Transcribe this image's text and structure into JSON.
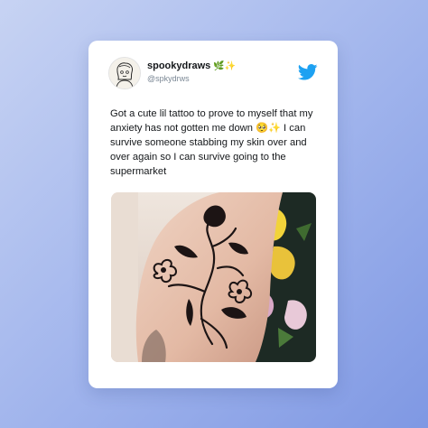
{
  "tweet": {
    "display_name": "spookydraws",
    "name_emoji": "🌿✨",
    "handle": "@spkydrws",
    "text": "Got a cute lil tattoo to prove to myself that my anxiety has not gotten me down 🥺✨ I can survive someone stabbing my skin over and over again so I can survive going to the supermarket",
    "icons": {
      "avatar": "avatar-illustration",
      "brand": "twitter-bird-icon"
    },
    "colors": {
      "brand_blue": "#1da1f2",
      "card_bg": "#ffffff",
      "text": "#14171a",
      "muted": "#7a8794",
      "background_start": "#c7d3f3",
      "background_end": "#7f98e3"
    },
    "photo": {
      "subject": "black-ink floral tattoo on forearm"
    }
  }
}
